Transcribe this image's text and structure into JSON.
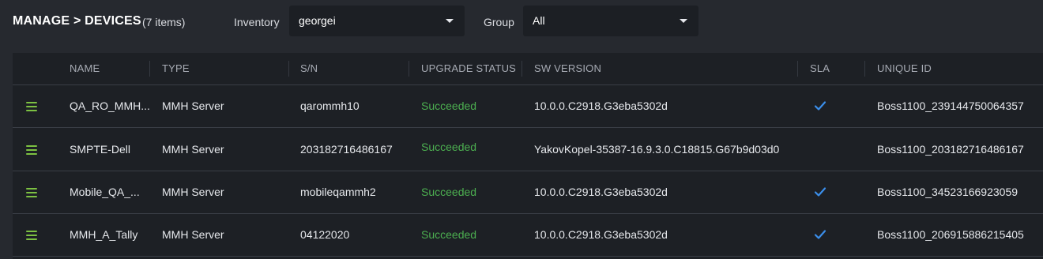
{
  "header": {
    "title": "MANAGE > DEVICES",
    "count": "(7 items)",
    "inventory_label": "Inventory",
    "inventory_value": "georgei",
    "group_label": "Group",
    "group_value": "All"
  },
  "table": {
    "columns": [
      "NAME",
      "TYPE",
      "S/N",
      "UPGRADE STATUS",
      "SW VERSION",
      "SLA",
      "UNIQUE ID"
    ],
    "rows": [
      {
        "name": "QA_RO_MMH...",
        "type": "MMH Server",
        "sn": "qarommh10",
        "status": "Succeeded",
        "sw": "10.0.0.C2918.G3eba5302d",
        "sla": true,
        "uid": "Boss1100_239144750064357"
      },
      {
        "name": "SMPTE-Dell",
        "type": "MMH Server",
        "sn": "203182716486167",
        "status": "Succeeded",
        "sw": "YakovKopel-35387-16.9.3.0.C18815.G67b9d03d0",
        "sla": false,
        "uid": "Boss1100_203182716486167"
      },
      {
        "name": "Mobile_QA_...",
        "type": "MMH Server",
        "sn": "mobileqammh2",
        "status": "Succeeded",
        "sw": "10.0.0.C2918.G3eba5302d",
        "sla": true,
        "uid": "Boss1100_34523166923059"
      },
      {
        "name": "MMH_A_Tally",
        "type": "MMH Server",
        "sn": "04122020",
        "status": "Succeeded",
        "sw": "10.0.0.C2918.G3eba5302d",
        "sla": true,
        "uid": "Boss1100_206915886215405"
      }
    ]
  },
  "colors": {
    "success": "#4caf50",
    "check": "#3b8eea",
    "menu_icon": "#7cc142"
  }
}
